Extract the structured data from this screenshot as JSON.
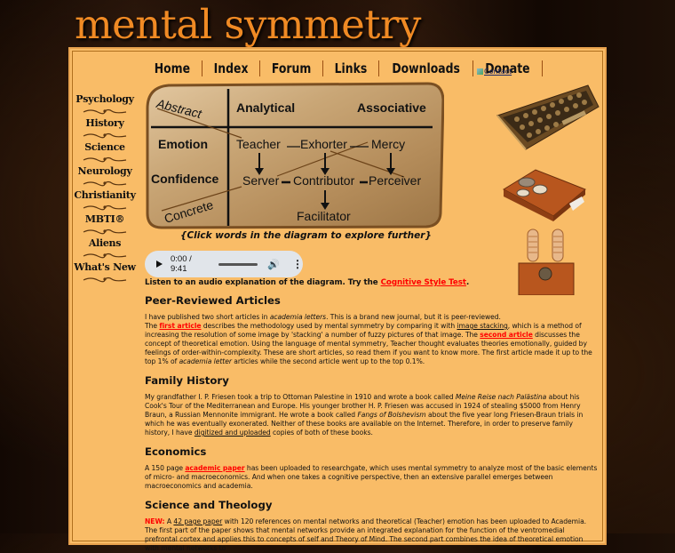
{
  "site": {
    "title": "mental symmetry"
  },
  "topnav": {
    "items": [
      {
        "label": "Home"
      },
      {
        "label": "Index"
      },
      {
        "label": "Forum"
      },
      {
        "label": "Links"
      },
      {
        "label": "Downloads"
      },
      {
        "label": "Donate"
      }
    ],
    "contact_alt": "Contact"
  },
  "leftnav": {
    "items": [
      {
        "label": "Psychology"
      },
      {
        "label": "History"
      },
      {
        "label": "Science"
      },
      {
        "label": "Neurology"
      },
      {
        "label": "Christianity"
      },
      {
        "label": "MBTI®"
      },
      {
        "label": "Aliens"
      },
      {
        "label": "What's New"
      }
    ]
  },
  "diagram": {
    "abstract": "Abstract",
    "concrete": "Concrete",
    "col_analytical": "Analytical",
    "col_associative": "Associative",
    "row_emotion": "Emotion",
    "row_confidence": "Confidence",
    "teacher": "Teacher",
    "exhorter": "Exhorter",
    "mercy": "Mercy",
    "server": "Server",
    "contributor": "Contributor",
    "perceiver": "Perceiver",
    "facilitator": "Facilitator",
    "caption": "{Click words in the diagram to explore further}"
  },
  "audio": {
    "time": "0:00 / 9:41"
  },
  "intro": {
    "text": "Listen to an audio explanation of the diagram. Try the ",
    "link": "Cognitive Style Test",
    "end": "."
  },
  "sections": {
    "peer": {
      "heading": "Peer-Reviewed Articles",
      "p1": "I have published two short articles in ",
      "p1_em": "academia letters",
      "p1b": ". This is a brand new journal, but it is peer-reviewed.",
      "p2_pre": "The ",
      "first_article": "first article",
      "p2a": " describes the methodology used by mental symmetry by comparing it with ",
      "image_stacking": "image stacking",
      "p2b": ", which is a method of increasing the resolution of some image by 'stacking' a number of fuzzy pictures of that image. The ",
      "second_article": "second article",
      "p2c": " discusses the concept of theoretical emotion. Using the language of mental symmetry, Teacher thought evaluates theories emotionally, guided by feelings of order-within-complexity. These are short articles, so read them if you want to know more. The first article made it up to the top 1% of ",
      "p2_em": "academia letter",
      "p2d": " articles while the second article went up to the top 0.1%."
    },
    "family": {
      "heading": "Family History",
      "a": "My grandfather I. P. Friesen took a trip to Ottoman Palestine in 1910 and wrote a book called ",
      "em1": "Meine Reise nach Palästina",
      "b": " about his Cook's Tour of the Mediterranean and Europe. His younger brother H. P. Friesen was accused in 1924 of stealing $5000 from Henry Braun, a Russian Mennonite immigrant. He wrote a book called ",
      "em2": "Fangs of Bolshevism",
      "c": " about the five year long Friesen-Braun trials in which he was eventually exonerated. Neither of these books are available on the Internet. Therefore, in order to preserve family history, I have ",
      "link": "digitized and uploaded",
      "d": " copies of both of these books."
    },
    "economics": {
      "heading": "Economics",
      "a": "A 150 page ",
      "link": "academic paper",
      "b": " has been uploaded to researchgate, which uses mental symmetry to analyze most of the basic elements of micro- and macroeconomics. And when one takes a cognitive perspective, then an extensive parallel emerges between macroeconomics and academia."
    },
    "science": {
      "heading": "Science and Theology",
      "new": "NEW:",
      "a": " A ",
      "link": "42 page paper",
      "b": " with 120 references on mental networks and theoretical (Teacher) emotion has been uploaded to Academia. The first part of the paper shows that mental networks provide an integrated explanation for the function of the ventromedial prefrontal cortex and applies this to concepts of self and Theory of Mind. The second part combines the idea of theoretical emotion with mental networks to"
    }
  },
  "colors": {
    "panel": "#f9bc67",
    "title": "#f08a24",
    "link_red": "#ff0000",
    "background": "#1a0d05"
  }
}
